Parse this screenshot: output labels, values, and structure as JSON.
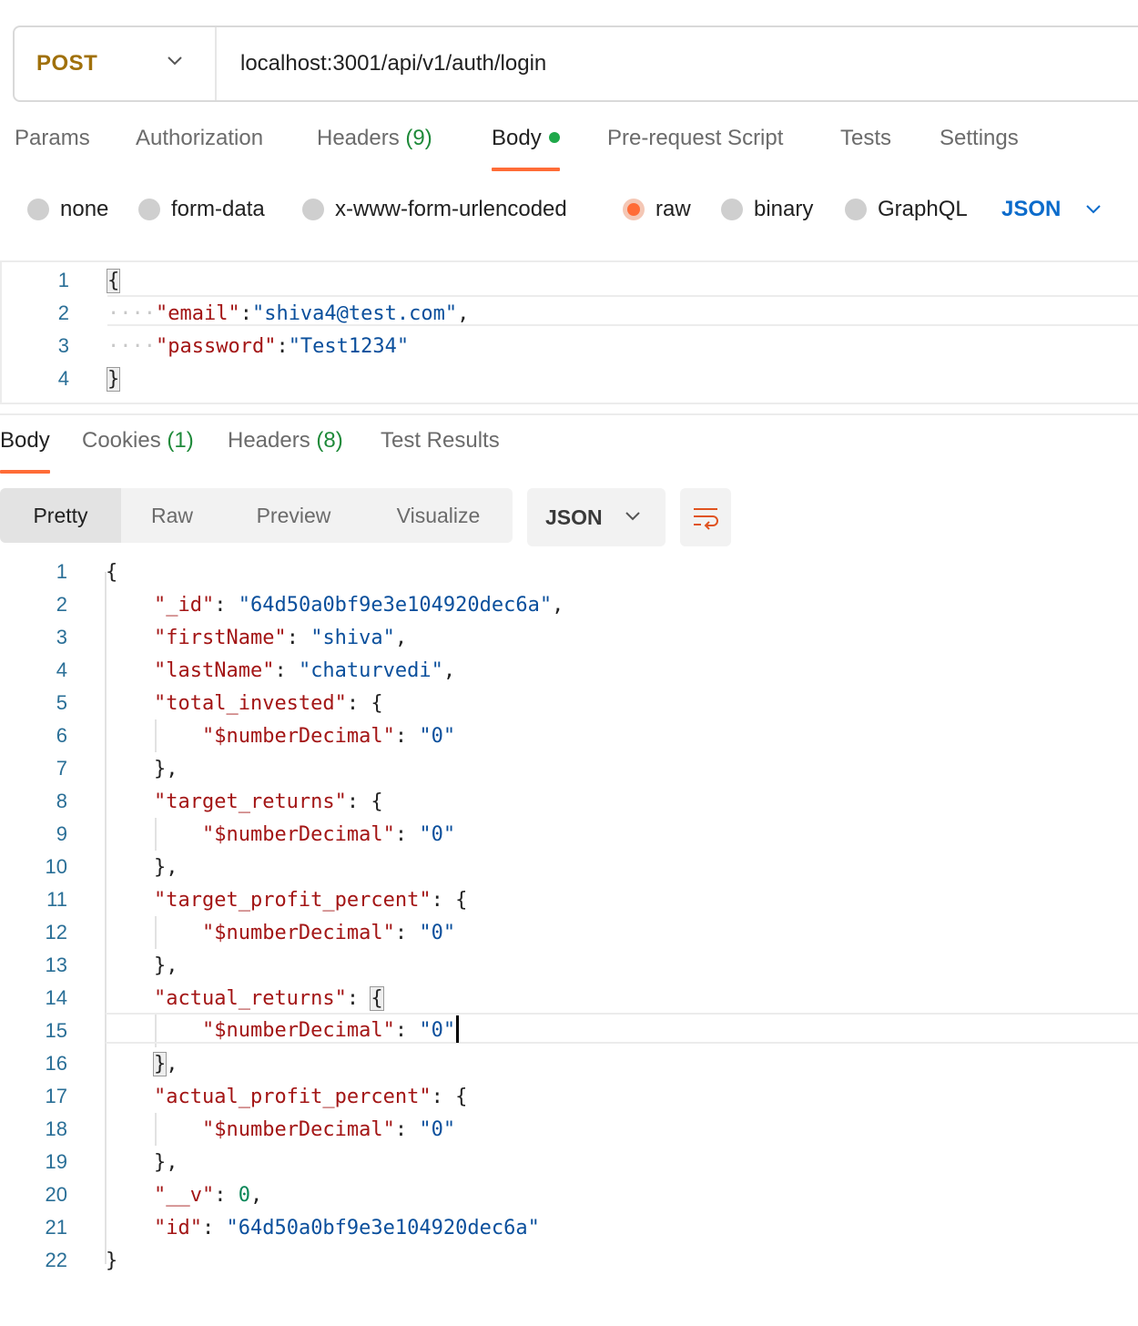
{
  "request": {
    "method": "POST",
    "url": "localhost:3001/api/v1/auth/login"
  },
  "request_tabs": [
    {
      "label": "Params"
    },
    {
      "label": "Authorization"
    },
    {
      "label": "Headers",
      "count": "(9)"
    },
    {
      "label": "Body",
      "active": true
    },
    {
      "label": "Pre-request Script"
    },
    {
      "label": "Tests"
    },
    {
      "label": "Settings"
    }
  ],
  "body_types": {
    "options": [
      "none",
      "form-data",
      "x-www-form-urlencoded",
      "raw",
      "binary",
      "GraphQL"
    ],
    "selected": "raw",
    "format": "JSON"
  },
  "request_body_lines": [
    "{",
    "\"email\":\"shiva4@test.com\",",
    "\"password\":\"Test1234\"",
    "}"
  ],
  "response_tabs": [
    {
      "label": "Body",
      "active": true
    },
    {
      "label": "Cookies",
      "count": "(1)"
    },
    {
      "label": "Headers",
      "count": "(8)"
    },
    {
      "label": "Test Results"
    }
  ],
  "view_modes": [
    "Pretty",
    "Raw",
    "Preview",
    "Visualize"
  ],
  "view_mode_selected": "Pretty",
  "response_format": "JSON",
  "response": {
    "_id": "64d50a0bf9e3e104920dec6a",
    "firstName": "shiva",
    "lastName": "chaturvedi",
    "numberDecimal_key": "$numberDecimal",
    "zero_string": "0",
    "keys": [
      "total_invested",
      "target_returns",
      "target_profit_percent",
      "actual_returns",
      "actual_profit_percent"
    ],
    "__v": "0",
    "id": "64d50a0bf9e3e104920dec6a"
  },
  "line_numbers": [
    "1",
    "2",
    "3",
    "4",
    "5",
    "6",
    "7",
    "8",
    "9",
    "10",
    "11",
    "12",
    "13",
    "14",
    "15",
    "16",
    "17",
    "18",
    "19",
    "20",
    "21",
    "22"
  ],
  "colors": {
    "accent": "#ff6c37",
    "method": "#a0700a",
    "json_key": "#a31515",
    "json_string": "#0a4f9c",
    "json_number": "#098658",
    "count_green": "#1f8a3a",
    "link_blue": "#0b6bcb"
  }
}
